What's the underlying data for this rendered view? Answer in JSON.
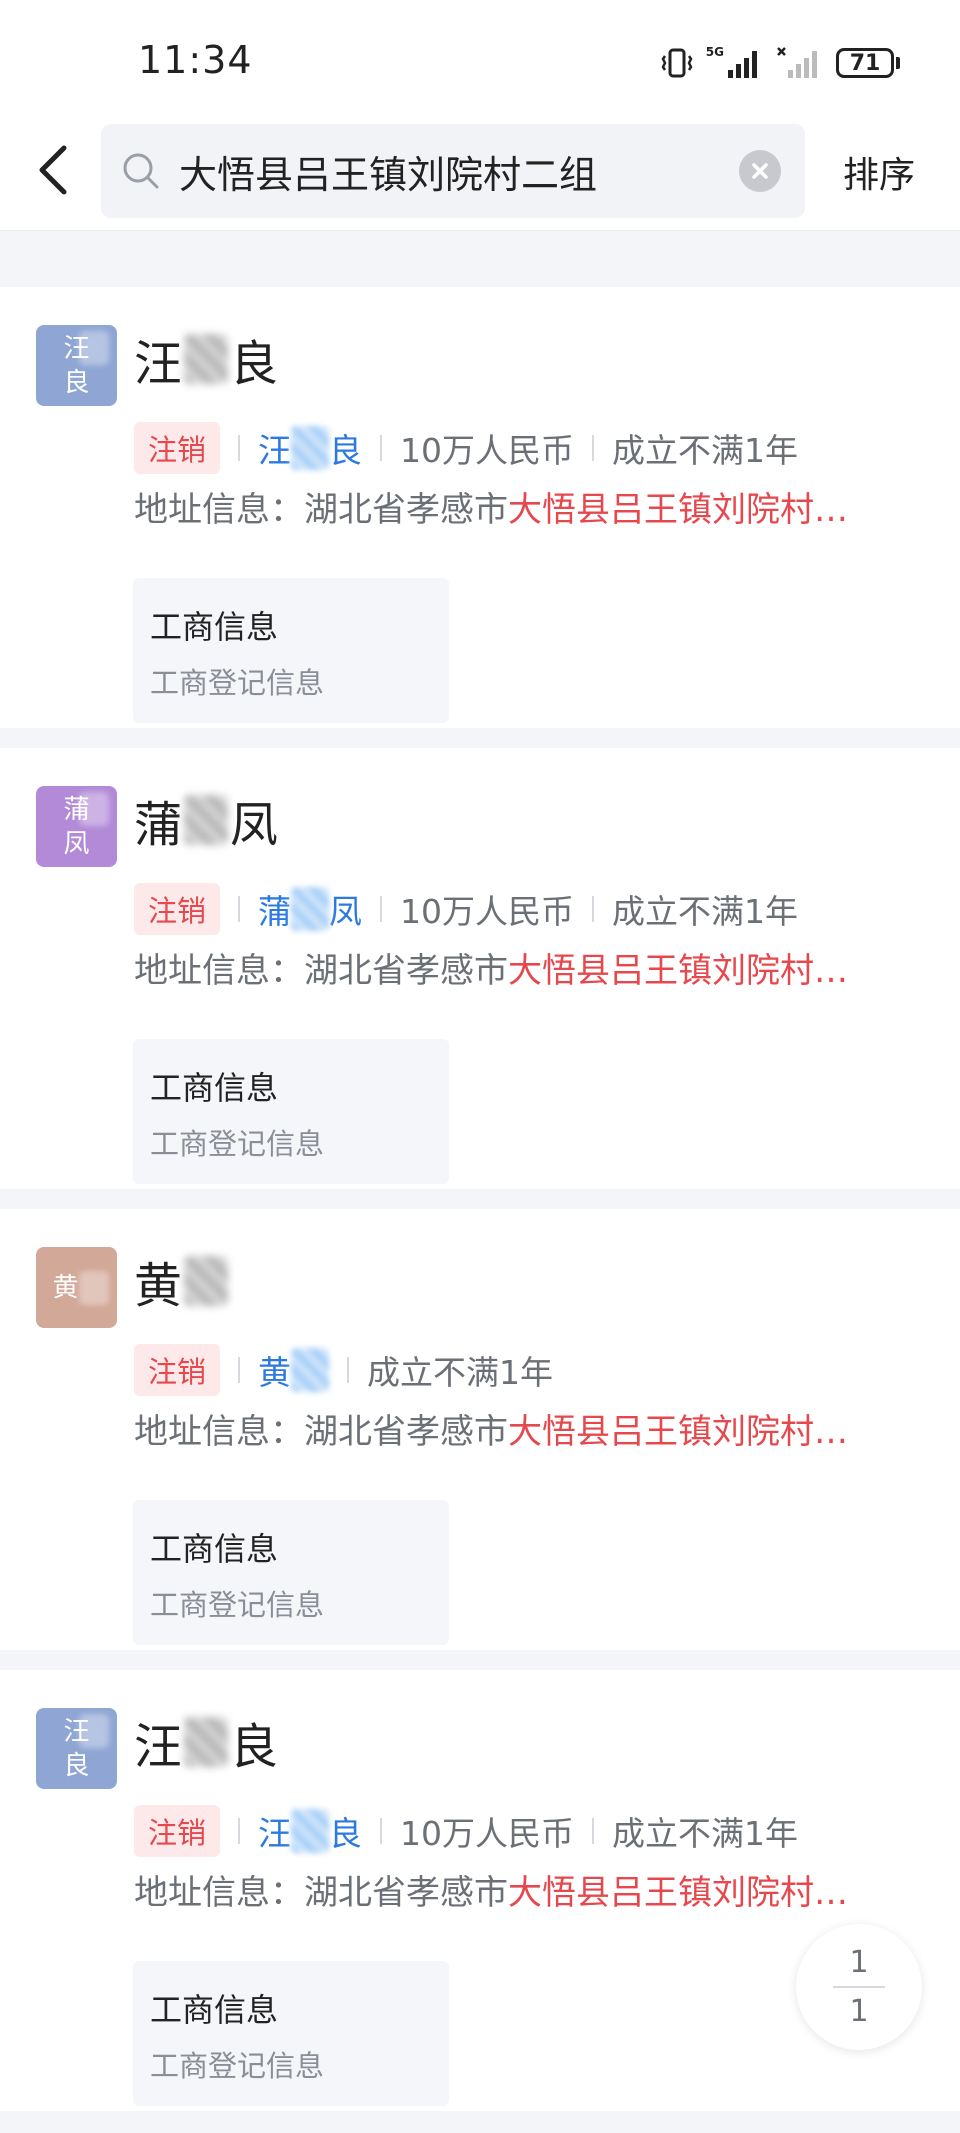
{
  "status_bar": {
    "time": "11:34",
    "network_label": "5G",
    "battery": "71"
  },
  "header": {
    "search_value": "大悟县吕王镇刘院村二组",
    "sort_label": "排序"
  },
  "results": [
    {
      "avatar_chars": [
        "汪",
        "良"
      ],
      "avatar_color": "#8fa6d4",
      "name_first": "汪",
      "name_last": "良",
      "status": "注销",
      "legal_rep_first": "汪",
      "legal_rep_last": "良",
      "capital": "10万人民币",
      "age": "成立不满1年",
      "address_prefix": "地址信息：湖北省孝感市",
      "address_highlight": "大悟县吕王镇刘院村…",
      "info_title": "工商信息",
      "info_sub": "工商登记信息"
    },
    {
      "avatar_chars": [
        "蒲",
        "凤"
      ],
      "avatar_color": "#b28ad8",
      "name_first": "蒲",
      "name_last": "凤",
      "status": "注销",
      "legal_rep_first": "蒲",
      "legal_rep_last": "凤",
      "capital": "10万人民币",
      "age": "成立不满1年",
      "address_prefix": "地址信息：湖北省孝感市",
      "address_highlight": "大悟县吕王镇刘院村…",
      "info_title": "工商信息",
      "info_sub": "工商登记信息"
    },
    {
      "avatar_chars": [
        "黄",
        ""
      ],
      "avatar_color": "#d2a898",
      "name_first": "黄",
      "name_last": "",
      "status": "注销",
      "legal_rep_first": "黄",
      "legal_rep_last": "",
      "capital": "",
      "age": "成立不满1年",
      "address_prefix": "地址信息：湖北省孝感市",
      "address_highlight": "大悟县吕王镇刘院村…",
      "info_title": "工商信息",
      "info_sub": "工商登记信息"
    },
    {
      "avatar_chars": [
        "汪",
        "良"
      ],
      "avatar_color": "#8fa6d4",
      "name_first": "汪",
      "name_last": "良",
      "status": "注销",
      "legal_rep_first": "汪",
      "legal_rep_last": "良",
      "capital": "10万人民币",
      "age": "成立不满1年",
      "address_prefix": "地址信息：湖北省孝感市",
      "address_highlight": "大悟县吕王镇刘院村…",
      "info_title": "工商信息",
      "info_sub": "工商登记信息"
    }
  ],
  "pager": {
    "current": "1",
    "total": "1"
  },
  "colors": {
    "accent_red": "#e5484d",
    "link_blue": "#2c7ae0",
    "background": "#f3f5f9"
  }
}
